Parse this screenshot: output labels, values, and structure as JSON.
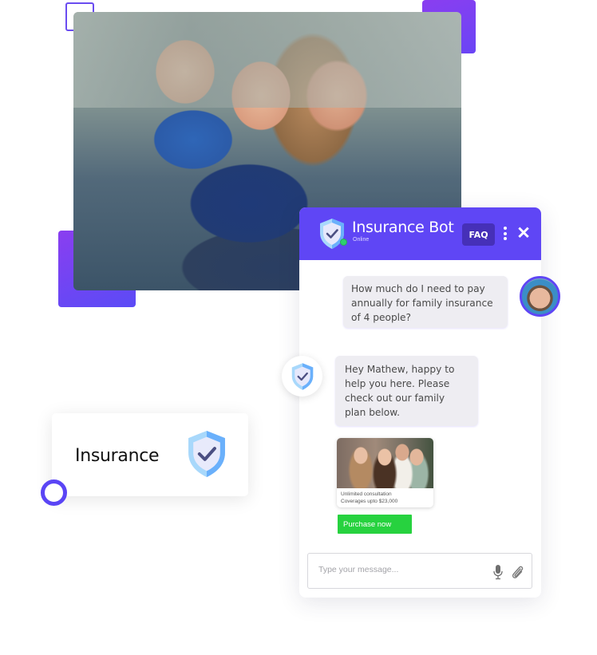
{
  "hero": {
    "image_alt": "Happy family of four laughing on a sofa"
  },
  "chat": {
    "header": {
      "bot_name": "Insurance Bot",
      "status": "Online",
      "faq_label": "FAQ",
      "menu_icon": "vertical-dots-icon",
      "close_icon": "close-icon",
      "close_glyph": "✕"
    },
    "messages": [
      {
        "sender": "user",
        "text": "How much do I need to pay annually for family insurance of 4 people?"
      },
      {
        "sender": "bot",
        "text": "Hey Mathew, happy to help you here. Please check out our family plan below."
      }
    ],
    "plan_card": {
      "image_alt": "Family of four smiling outdoors",
      "line1": "Unlimited consultation",
      "line2": "Coverages upto $23,000"
    },
    "purchase_label": "Purchase now",
    "input": {
      "placeholder": "Type your message..."
    }
  },
  "insurance_card": {
    "label": "Insurance"
  },
  "colors": {
    "brand_purple": "#5f46f5",
    "faq_bg": "#4630b8",
    "purchase_green": "#27d23f",
    "online_green": "#2ed06e",
    "bubble_bg": "#eeedf2"
  }
}
